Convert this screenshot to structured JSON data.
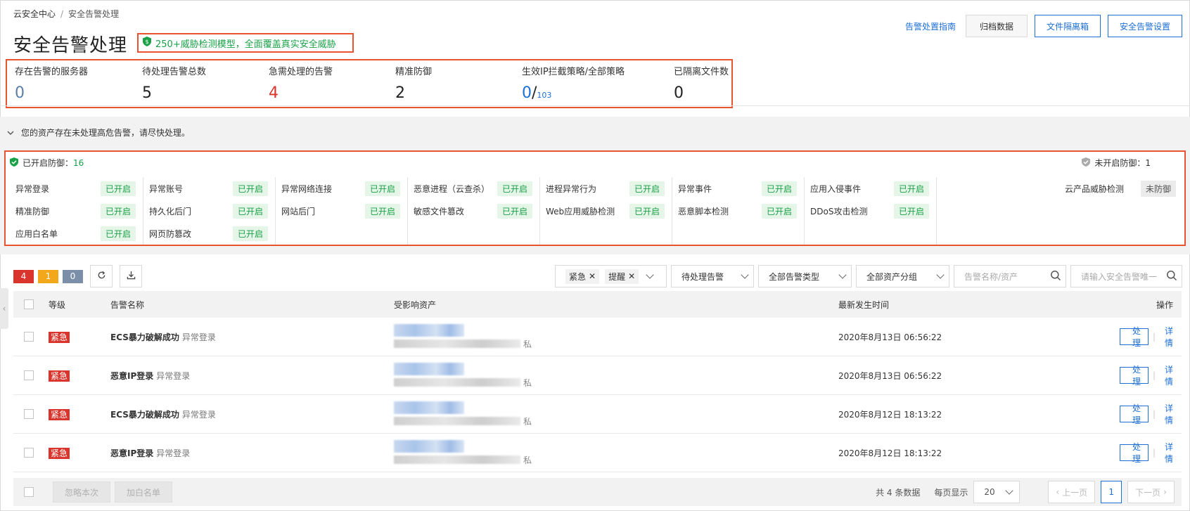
{
  "breadcrumb": {
    "root": "云安全中心",
    "sep": "/",
    "current": "安全告警处理"
  },
  "page": {
    "title": "安全告警处理",
    "promo": "250+威胁检测模型，全面覆盖真实安全威胁"
  },
  "top_actions": {
    "guide_link": "告警处置指南",
    "archive": "归档数据",
    "quarantine": "文件隔离箱",
    "settings": "安全告警设置"
  },
  "stats": [
    {
      "label": "存在告警的服务器",
      "value": "0"
    },
    {
      "label": "待处理告警总数",
      "value": "5"
    },
    {
      "label": "急需处理的告警",
      "value": "4"
    },
    {
      "label": "精准防御",
      "value": "2"
    },
    {
      "label": "生效IP拦截策略/全部策略",
      "value": "0",
      "sep": "/",
      "total": "103"
    },
    {
      "label": "已隔离文件数",
      "value": "0"
    }
  ],
  "banner": {
    "text": "您的资产存在未处理高危告警，请尽快处理。"
  },
  "protection": {
    "enabled_label": "已开启防御：",
    "enabled_count": "16",
    "disabled_label": "未开启防御：",
    "disabled_count": "1",
    "on_tag": "已开启",
    "columns": [
      [
        "异常登录",
        "精准防御",
        "应用白名单"
      ],
      [
        "异常账号",
        "持久化后门",
        "网页防篡改"
      ],
      [
        "异常网络连接",
        "网站后门"
      ],
      [
        "恶意进程（云查杀）",
        "敏感文件篡改"
      ],
      [
        "进程异常行为",
        "Web应用威胁检测"
      ],
      [
        "异常事件",
        "恶意脚本检测"
      ],
      [
        "应用入侵事件",
        "DDoS攻击检测"
      ]
    ],
    "disabled_items": [
      {
        "name": "云产品威胁检测",
        "tag": "未防御"
      }
    ]
  },
  "toolbar": {
    "counts": {
      "urgent": "4",
      "warning": "1",
      "notice": "0"
    },
    "chips": [
      "紧急",
      "提醒"
    ],
    "status_select": "待处理告警",
    "type_select": "全部告警类型",
    "group_select": "全部资产分组",
    "search_name_placeholder": "告警名称/资产",
    "search_id_placeholder": "请输入安全告警唯一"
  },
  "table": {
    "headers": {
      "level": "等级",
      "name": "告警名称",
      "asset": "受影响资产",
      "time": "最新发生时间",
      "op": "操作"
    },
    "rows": [
      {
        "level": "紧急",
        "name": "ECS暴力破解成功",
        "type": "异常登录",
        "asset_suffix": "私",
        "time": "2020年8月13日 06:56:22",
        "handle": "处理",
        "detail": "详情"
      },
      {
        "level": "紧急",
        "name": "恶意IP登录",
        "type": "异常登录",
        "asset_suffix": "私",
        "time": "2020年8月13日 06:56:22",
        "handle": "处理",
        "detail": "详情"
      },
      {
        "level": "紧急",
        "name": "ECS暴力破解成功",
        "type": "异常登录",
        "asset_suffix": "私",
        "time": "2020年8月12日 18:13:22",
        "handle": "处理",
        "detail": "详情"
      },
      {
        "level": "紧急",
        "name": "恶意IP登录",
        "type": "异常登录",
        "asset_suffix": "私",
        "time": "2020年8月12日 18:13:22",
        "handle": "处理",
        "detail": "详情"
      }
    ]
  },
  "footer": {
    "ignore": "忽略本次",
    "whitelist": "加白名单",
    "total": "共 4 条数据",
    "per_page_label": "每页显示",
    "per_page": "20",
    "prev": "上一页",
    "page": "1",
    "next": "下一页"
  },
  "colors": {
    "accent": "#1d6fd6",
    "urgent": "#d9352c",
    "success": "#1aa148",
    "highlight": "#e8542f"
  }
}
